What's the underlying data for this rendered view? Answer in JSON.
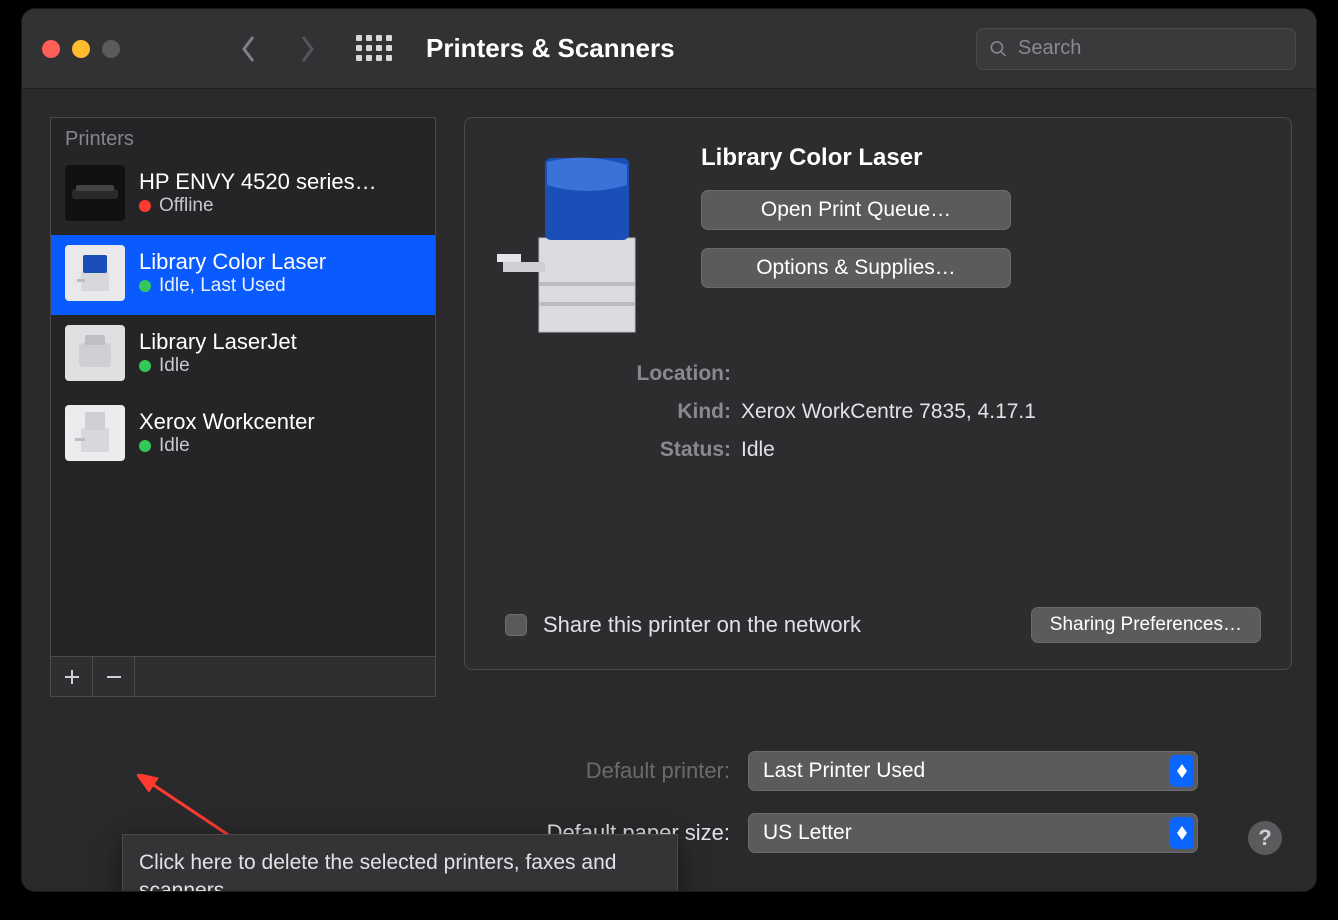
{
  "window_title": "Printers & Scanners",
  "search": {
    "placeholder": "Search"
  },
  "sidebar": {
    "header": "Printers",
    "items": [
      {
        "name": "HP ENVY 4520 series…",
        "status": "Offline",
        "status_color": "red",
        "selected": false
      },
      {
        "name": "Library Color Laser",
        "status": "Idle, Last Used",
        "status_color": "green",
        "selected": true
      },
      {
        "name": "Library LaserJet",
        "status": "Idle",
        "status_color": "green",
        "selected": false
      },
      {
        "name": "Xerox Workcenter",
        "status": "Idle",
        "status_color": "green",
        "selected": false
      }
    ]
  },
  "detail": {
    "title": "Library Color Laser",
    "open_queue_label": "Open Print Queue…",
    "options_label": "Options & Supplies…",
    "location_label": "Location:",
    "location_value": "",
    "kind_label": "Kind:",
    "kind_value": "Xerox WorkCentre 7835, 4.17.1",
    "status_label": "Status:",
    "status_value": "Idle",
    "share_label": "Share this printer on the network",
    "share_prefs_label": "Sharing Preferences…"
  },
  "defaults": {
    "printer_label": "Default printer:",
    "printer_value": "Last Printer Used",
    "paper_label": "Default paper size:",
    "paper_value": "US Letter"
  },
  "tooltip": "Click here to delete the selected printers, faxes and scanners",
  "help_glyph": "?"
}
